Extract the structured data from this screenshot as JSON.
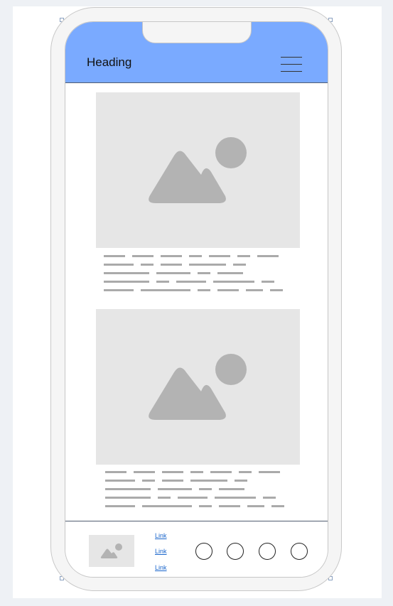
{
  "header": {
    "title": "Heading",
    "background_color": "#7aaaff",
    "menu_icon": "hamburger-menu-icon"
  },
  "cards": [
    {
      "image_icon": "image-placeholder-icon",
      "text": "placeholder-text-lines"
    },
    {
      "image_icon": "image-placeholder-icon",
      "text": "placeholder-text-lines"
    }
  ],
  "footer": {
    "image_icon": "image-placeholder-icon",
    "links": [
      "Link",
      "Link",
      "Link"
    ],
    "buttons": [
      "circle-button",
      "circle-button",
      "circle-button",
      "circle-button"
    ],
    "link_color": "#1a66cc"
  }
}
